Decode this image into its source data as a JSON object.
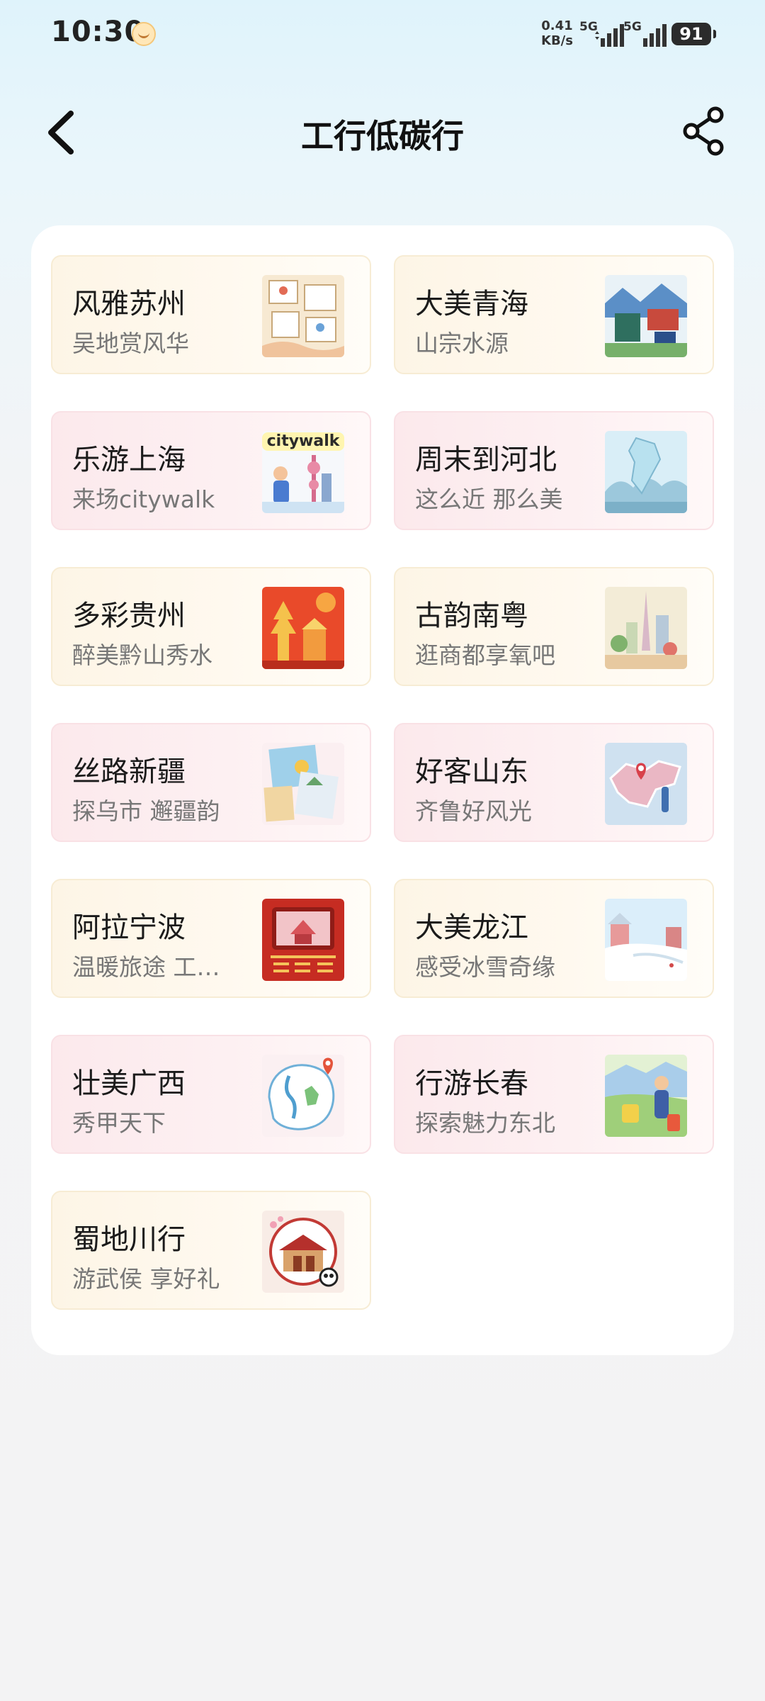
{
  "status_bar": {
    "time": "10:30",
    "net_speed_value": "0.41",
    "net_speed_unit": "KB/s",
    "signal1_label": "5G",
    "signal2_label": "5G",
    "battery": "91"
  },
  "header": {
    "title": "工行低碳行",
    "back_icon": "back-arrow-icon",
    "share_icon": "share-icon"
  },
  "cards": [
    {
      "title": "风雅苏州",
      "subtitle": "吴地赏风华",
      "theme": "yellow"
    },
    {
      "title": "大美青海",
      "subtitle": "山宗水源",
      "theme": "yellow"
    },
    {
      "title": "乐游上海",
      "subtitle": "来场citywalk",
      "theme": "pink",
      "badge": "citywalk"
    },
    {
      "title": "周末到河北",
      "subtitle": "这么近 那么美",
      "theme": "pink"
    },
    {
      "title": "多彩贵州",
      "subtitle": "醉美黔山秀水",
      "theme": "yellow"
    },
    {
      "title": "古韵南粤",
      "subtitle": "逛商都享氧吧",
      "theme": "yellow"
    },
    {
      "title": "丝路新疆",
      "subtitle": "探乌市 邂疆韵",
      "theme": "pink"
    },
    {
      "title": "好客山东",
      "subtitle": "齐鲁好风光",
      "theme": "pink"
    },
    {
      "title": "阿拉宁波",
      "subtitle": "温暖旅途 工…",
      "theme": "yellow"
    },
    {
      "title": "大美龙江",
      "subtitle": "感受冰雪奇缘",
      "theme": "yellow"
    },
    {
      "title": "壮美广西",
      "subtitle": "秀甲天下",
      "theme": "pink"
    },
    {
      "title": "行游长春",
      "subtitle": "探索魅力东北",
      "theme": "pink"
    },
    {
      "title": "蜀地川行",
      "subtitle": "游武侯 享好礼",
      "theme": "yellow"
    }
  ]
}
